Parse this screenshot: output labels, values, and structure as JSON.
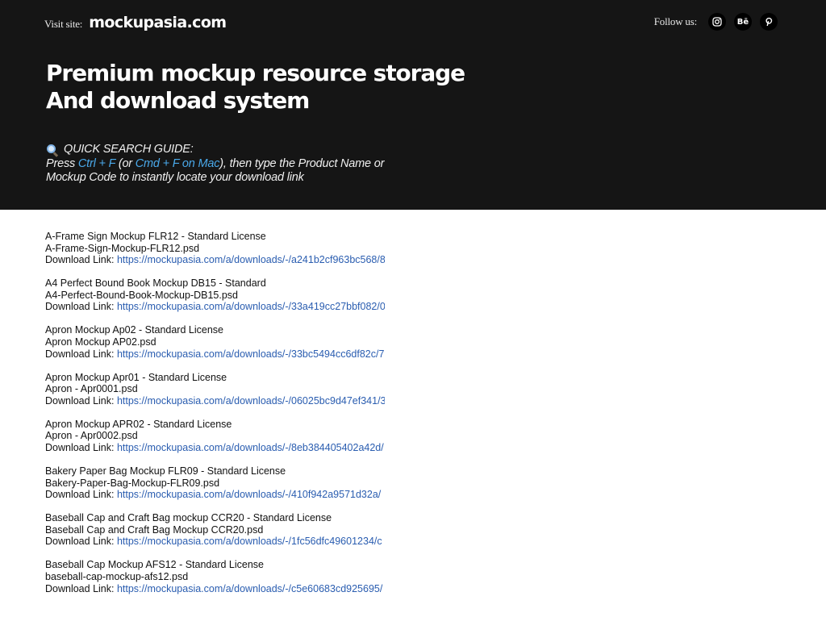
{
  "header": {
    "visit_label": "Visit site:",
    "visit_site": "mockupasia.com",
    "follow_label": "Follow us:",
    "social": [
      {
        "name": "instagram-icon",
        "glyph": ""
      },
      {
        "name": "behance-icon",
        "glyph": "Bē"
      },
      {
        "name": "pinterest-icon",
        "glyph": "P"
      }
    ],
    "headline_line1": "Premium mockup resource storage",
    "headline_line2": "And download system",
    "guide": {
      "title": "QUICK SEARCH GUIDE:",
      "t1": "Press ",
      "k1": "Ctrl + F",
      "t2": " (or ",
      "k2": "Cmd + F on Mac",
      "t3": "), then type the Product Name or Mockup Code to instantly locate your download link"
    }
  },
  "entries": [
    {
      "title": "A-Frame Sign Mockup FLR12 - Standard License",
      "file": "A-Frame-Sign-Mockup-FLR12.psd",
      "label": "Download Link: ",
      "url": "https://mockupasia.com/a/downloads/-/a241b2cf963bc568/8"
    },
    {
      "title": "A4 Perfect Bound Book Mockup DB15 - Standard",
      "file": "A4-Perfect-Bound-Book-Mockup-DB15.psd",
      "label": "Download Link: ",
      "url": "https://mockupasia.com/a/downloads/-/33a419cc27bbf082/0"
    },
    {
      "title": "Apron Mockup Ap02 - Standard License",
      "file": "Apron Mockup AP02.psd",
      "label": "Download Link: ",
      "url": "https://mockupasia.com/a/downloads/-/33bc5494cc6df82c/7"
    },
    {
      "title": "Apron Mockup Apr01 - Standard License",
      "file": "Apron - Apr0001.psd",
      "label": "Download Link: ",
      "url": "https://mockupasia.com/a/downloads/-/06025bc9d47ef341/3"
    },
    {
      "title": "Apron Mockup APR02 - Standard License",
      "file": "Apron - Apr0002.psd",
      "label": "Download Link: ",
      "url": "https://mockupasia.com/a/downloads/-/8eb384405402a42d/"
    },
    {
      "title": "Bakery Paper Bag Mockup FLR09 - Standard License",
      "file": "Bakery-Paper-Bag-Mockup-FLR09.psd",
      "label": "Download Link: ",
      "url": "https://mockupasia.com/a/downloads/-/410f942a9571d32a/"
    },
    {
      "title": "Baseball Cap and Craft Bag mockup CCR20 - Standard License",
      "file": "Baseball Cap and Craft Bag Mockup CCR20.psd",
      "label": "Download Link: ",
      "url": "https://mockupasia.com/a/downloads/-/1fc56dfc49601234/c"
    },
    {
      "title": "Baseball Cap Mockup AFS12 - Standard License",
      "file": "baseball-cap-mockup-afs12.psd",
      "label": "Download Link: ",
      "url": "https://mockupasia.com/a/downloads/-/c5e60683cd925695/"
    }
  ]
}
